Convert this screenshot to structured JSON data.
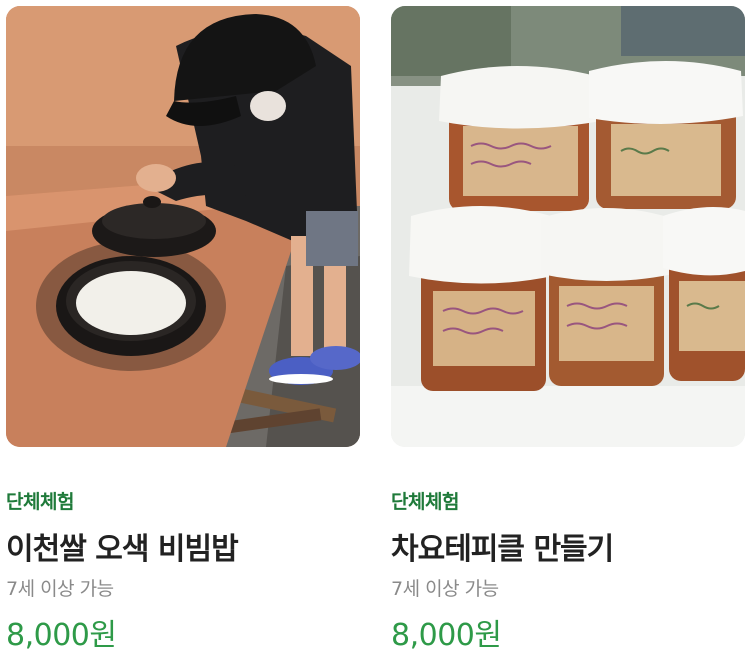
{
  "products": [
    {
      "image_alt": "child lifting the lid of a black iron pot with rice",
      "category": "단체체험",
      "title": "이천쌀 오색 비빔밥",
      "age_note": "7세 이상 가능",
      "price": "8,000원"
    },
    {
      "image_alt": "jars of jam with lace covers and handwritten labels",
      "category": "단체체험",
      "title": "차요테피클 만들기",
      "age_note": "7세 이상 가능",
      "price": "8,000원"
    }
  ],
  "colors": {
    "category": "#1f7a3a",
    "price": "#2e9a48",
    "title": "#222222",
    "subtext": "#8a8a8a"
  }
}
